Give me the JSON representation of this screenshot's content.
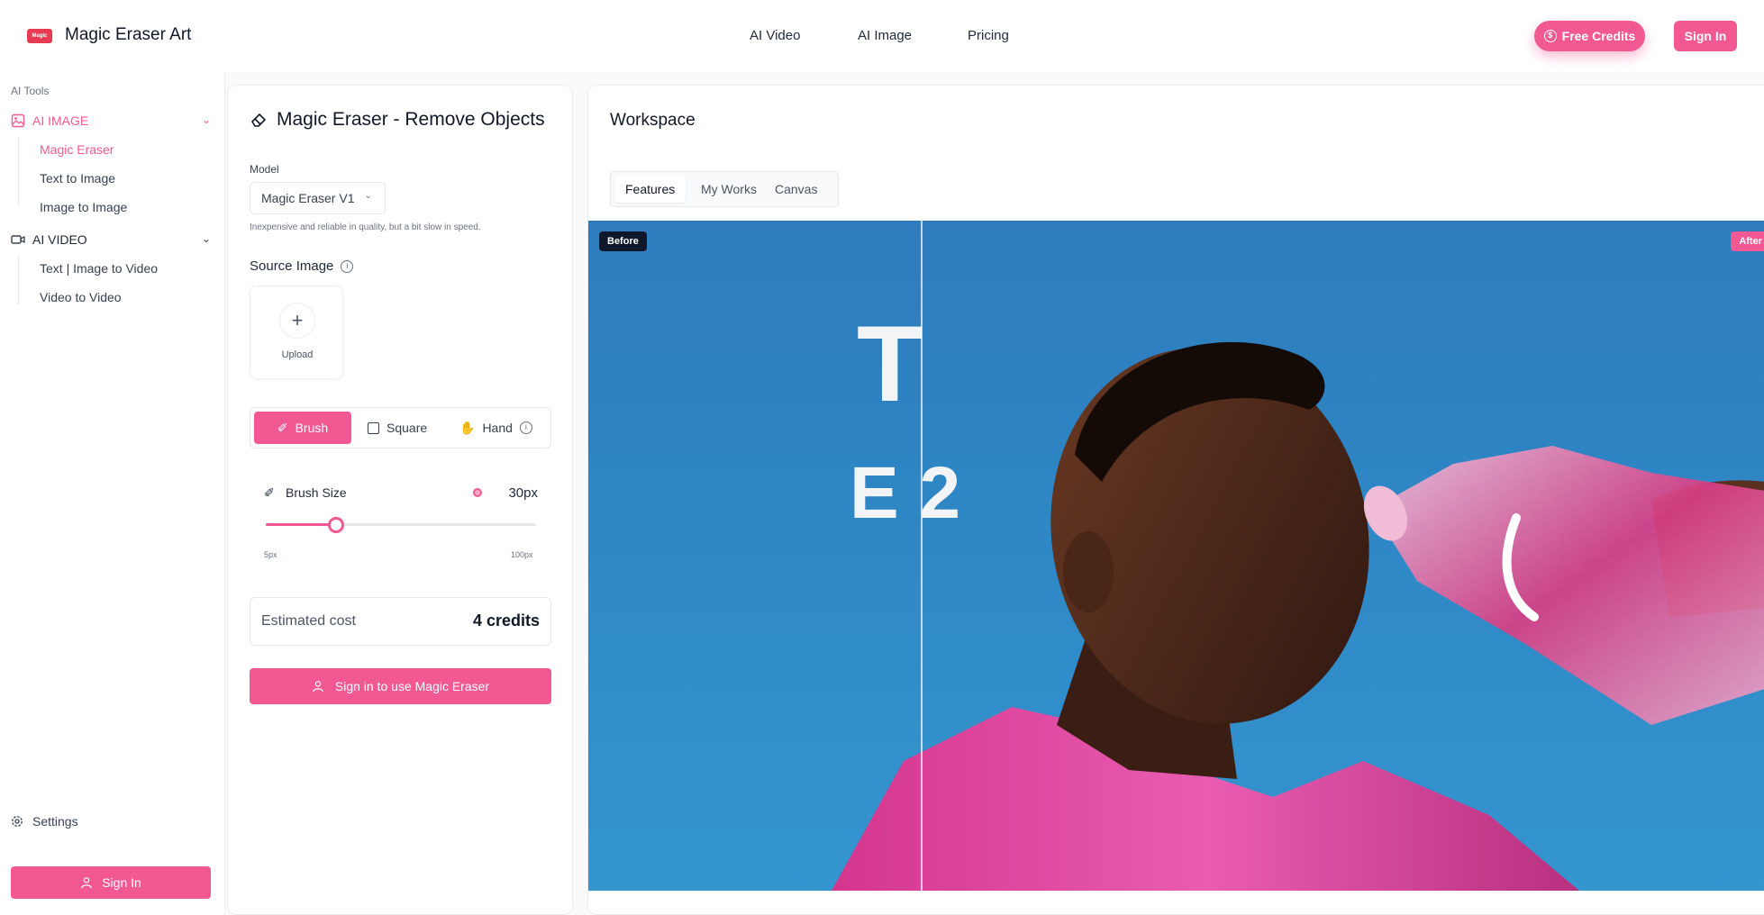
{
  "brand": {
    "logo_text": "Magic",
    "name": "Magic Eraser Art"
  },
  "nav": {
    "ai_video": "AI Video",
    "ai_image": "AI Image",
    "pricing": "Pricing"
  },
  "header": {
    "free_credits": "Free Credits",
    "sign_in": "Sign In"
  },
  "sidebar": {
    "section_label": "AI Tools",
    "groups": [
      {
        "label": "AI IMAGE",
        "items": [
          "Magic Eraser",
          "Text to Image",
          "Image to Image"
        ]
      },
      {
        "label": "AI VIDEO",
        "items": [
          "Text | Image to Video",
          "Video to Video"
        ]
      }
    ],
    "settings": "Settings",
    "sign_in": "Sign In"
  },
  "panel": {
    "title": "Magic Eraser - Remove Objects",
    "model_label": "Model",
    "model_value": "Magic Eraser V1",
    "model_hint": "Inexpensive and reliable in quality, but a bit slow in speed.",
    "source_label": "Source Image",
    "upload": "Upload",
    "tools": {
      "brush": "Brush",
      "square": "Square",
      "hand": "Hand"
    },
    "brush_size_label": "Brush Size",
    "brush_size_value": "30px",
    "brush_size_fraction": 0.26,
    "brush_min": "5px",
    "brush_max": "100px",
    "cost_label": "Estimated cost",
    "cost_value": "4 credits",
    "cta": "Sign in to use Magic Eraser"
  },
  "workspace": {
    "title": "Workspace",
    "tabs": [
      "Features",
      "My Works",
      "Canvas"
    ],
    "before": "Before",
    "after": "After",
    "overlay_text_1": "T",
    "overlay_text_2": "E 2"
  },
  "colors": {
    "accent": "#f25891",
    "logo": "#e63b52",
    "sky": "#2e86c4"
  }
}
